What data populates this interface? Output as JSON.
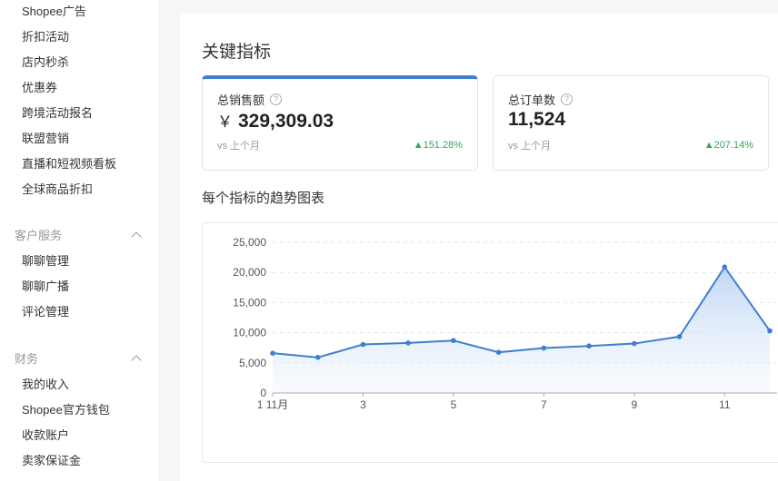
{
  "sidebar": {
    "marketing_items": [
      "Shopee广告",
      "折扣活动",
      "店内秒杀",
      "优惠券",
      "跨境活动报名",
      "联盟营销",
      "直播和短视频看板",
      "全球商品折扣"
    ],
    "customer_service": {
      "title": "客户服务",
      "items": [
        "聊聊管理",
        "聊聊广播",
        "评论管理"
      ]
    },
    "finance": {
      "title": "财务",
      "items": [
        "我的收入",
        "Shopee官方钱包",
        "收款账户",
        "卖家保证金"
      ]
    }
  },
  "main": {
    "title": "关键指标",
    "cards": [
      {
        "label": "总销售额",
        "currency": "￥",
        "value": "329,309.03",
        "vs": "vs 上个月",
        "change": "▲151.28%"
      },
      {
        "label": "总订单数",
        "value": "11,524",
        "vs": "vs 上个月",
        "change": "▲207.14%"
      }
    ],
    "trend_title": "每个指标的趋势图表"
  },
  "colors": {
    "accent": "#3f7fcf",
    "positive": "#3aa55a"
  },
  "chart_data": {
    "type": "area",
    "x": [
      1,
      2,
      3,
      4,
      5,
      6,
      7,
      8,
      9,
      10,
      11,
      12
    ],
    "x_tick_labels": [
      "1 11月",
      "3",
      "5",
      "7",
      "9",
      "11"
    ],
    "series": [
      {
        "name": "总销售额",
        "values": [
          6600,
          5900,
          8050,
          8300,
          8700,
          6750,
          7450,
          7800,
          8200,
          9350,
          20900,
          10300
        ]
      }
    ],
    "y_ticks": [
      "0",
      "5,000",
      "10,000",
      "15,000",
      "20,000",
      "25,000"
    ],
    "ylim": [
      0,
      25000
    ],
    "grid": true
  }
}
